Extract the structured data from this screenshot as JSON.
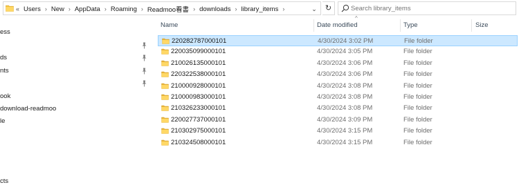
{
  "address_bar": {
    "overflow": "«",
    "breadcrumbs": [
      "Users",
      "New",
      "AppData",
      "Roaming",
      "Readmoo看書",
      "downloads",
      "library_items"
    ],
    "dropdown_glyph": "⌄",
    "refresh_glyph": "↻"
  },
  "search": {
    "placeholder": "Search library_items"
  },
  "nav_pane": {
    "items": [
      "ess",
      "ds",
      "nts",
      "ook",
      "download-readmoo",
      "le",
      "cts"
    ]
  },
  "columns": {
    "name": "Name",
    "date_modified": "Date modified",
    "type": "Type",
    "size": "Size",
    "sort_indicator": "^"
  },
  "files": [
    {
      "name": "220282787000101",
      "date": "4/30/2024 3:02 PM",
      "type": "File folder",
      "selected": true
    },
    {
      "name": "220035099000101",
      "date": "4/30/2024 3:05 PM",
      "type": "File folder"
    },
    {
      "name": "210026135000101",
      "date": "4/30/2024 3:06 PM",
      "type": "File folder"
    },
    {
      "name": "220322538000101",
      "date": "4/30/2024 3:06 PM",
      "type": "File folder"
    },
    {
      "name": "210000928000101",
      "date": "4/30/2024 3:08 PM",
      "type": "File folder"
    },
    {
      "name": "210000983000101",
      "date": "4/30/2024 3:08 PM",
      "type": "File folder"
    },
    {
      "name": "210326233000101",
      "date": "4/30/2024 3:08 PM",
      "type": "File folder"
    },
    {
      "name": "220027737000101",
      "date": "4/30/2024 3:09 PM",
      "type": "File folder"
    },
    {
      "name": "210302975000101",
      "date": "4/30/2024 3:15 PM",
      "type": "File folder"
    },
    {
      "name": "210324508000101",
      "date": "4/30/2024 3:15 PM",
      "type": "File folder"
    }
  ],
  "colors": {
    "selection_bg": "#cce8ff",
    "selection_border": "#99d1ff",
    "folder_yellow": "#f5c542"
  }
}
